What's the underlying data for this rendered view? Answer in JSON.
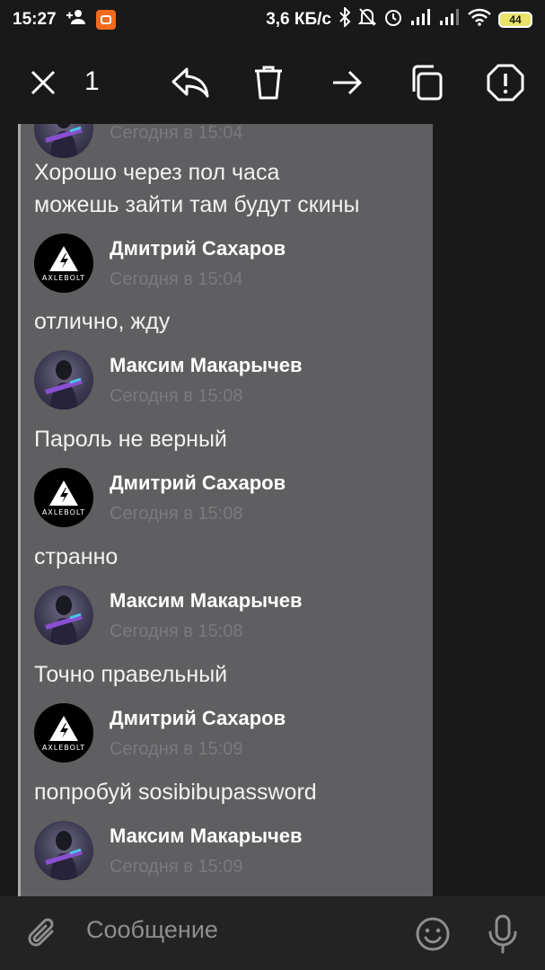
{
  "status_bar": {
    "time": "15:27",
    "net_speed": "3,6 КБ/с",
    "battery": "44"
  },
  "toolbar": {
    "selected_count": "1"
  },
  "messages": [
    {
      "kind": "avatar_row",
      "author": "",
      "time": "Сегодня в 15:04",
      "avatar": "soldier",
      "partial": true
    },
    {
      "kind": "text",
      "text_lines": [
        "Хорошо через пол часа",
        "можешь зайти там будут скины"
      ]
    },
    {
      "kind": "avatar_row",
      "author": "Дмитрий Сахаров",
      "time": "Сегодня в 15:04",
      "avatar": "axlebolt"
    },
    {
      "kind": "text",
      "text_lines": [
        "отлично, жду"
      ]
    },
    {
      "kind": "avatar_row",
      "author": "Максим Макарычев",
      "time": "Сегодня в 15:08",
      "avatar": "soldier"
    },
    {
      "kind": "text",
      "text_lines": [
        "Пароль не верный"
      ]
    },
    {
      "kind": "avatar_row",
      "author": "Дмитрий Сахаров",
      "time": "Сегодня в 15:08",
      "avatar": "axlebolt"
    },
    {
      "kind": "text",
      "text_lines": [
        "странно"
      ]
    },
    {
      "kind": "avatar_row",
      "author": "Максим Макарычев",
      "time": "Сегодня в 15:08",
      "avatar": "soldier"
    },
    {
      "kind": "text",
      "text_lines": [
        "Точно правельный"
      ]
    },
    {
      "kind": "avatar_row",
      "author": "Дмитрий Сахаров",
      "time": "Сегодня в 15:09",
      "avatar": "axlebolt"
    },
    {
      "kind": "text",
      "text_lines": [
        "попробуй sosibibupassword"
      ]
    },
    {
      "kind": "avatar_row",
      "author": "Максим Макарычев",
      "time": "Сегодня в 15:09",
      "avatar": "soldier"
    }
  ],
  "avatar_label": "AXLEBOLT",
  "composer": {
    "placeholder": "Сообщение"
  },
  "icons": {
    "close": "close-icon",
    "reply": "reply-icon",
    "delete": "trash-icon",
    "forward": "forward-icon",
    "copy": "copy-icon",
    "report": "report-icon",
    "scroll_down": "chevron-down-icon",
    "attach": "paperclip-icon",
    "emoji": "emoji-icon",
    "mic": "microphone-icon"
  },
  "colors": {
    "background": "#191919",
    "forward_block": "#5f5f61",
    "time_text": "#7a7a7d",
    "composer_bg": "#232323"
  }
}
